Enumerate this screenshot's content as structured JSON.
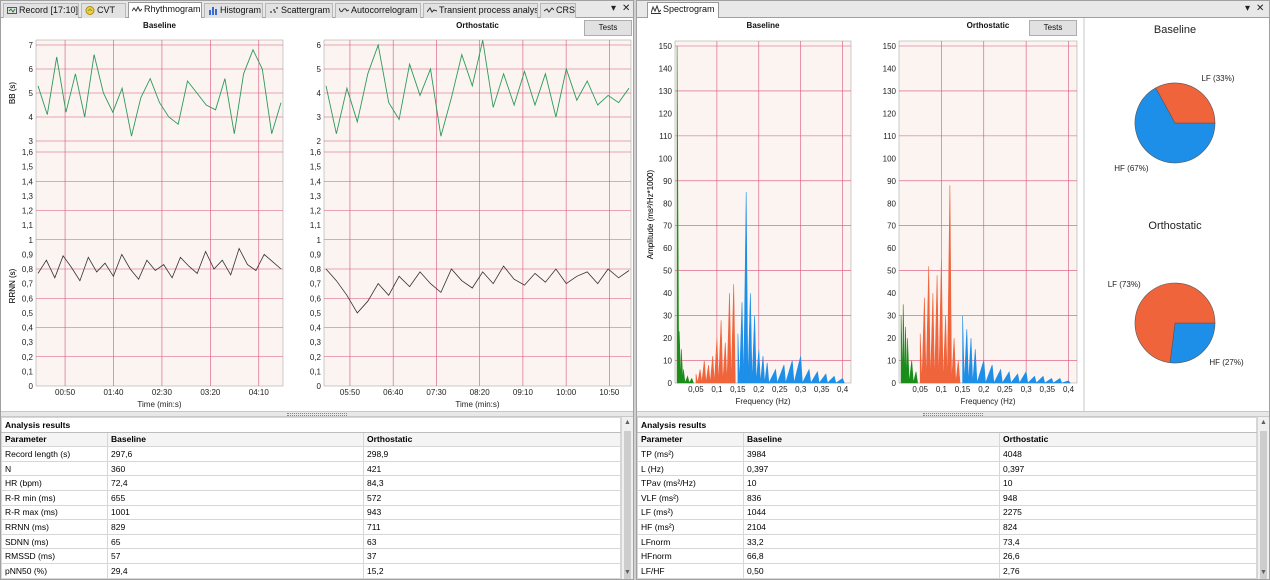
{
  "left_tabs": [
    {
      "label": "Record [17:10]",
      "icon": "record-icon"
    },
    {
      "label": "CVT",
      "icon": "cvt-icon"
    },
    {
      "label": "Rhythmogram",
      "icon": "rhythmogram-icon",
      "active": true
    },
    {
      "label": "Histogram",
      "icon": "histogram-icon"
    },
    {
      "label": "Scattergram",
      "icon": "scattergram-icon"
    },
    {
      "label": "Autocorrelogram",
      "icon": "autocorrelogram-icon"
    },
    {
      "label": "Transient process analysis",
      "icon": "transient-icon"
    },
    {
      "label": "CRS",
      "icon": "crs-icon"
    }
  ],
  "right_tabs": [
    {
      "label": "Spectrogram",
      "icon": "spectrogram-icon",
      "active": true
    }
  ],
  "window_controls": {
    "pin": "▾",
    "close": "✕"
  },
  "tests_label": "Tests",
  "colors": {
    "grid_red": "#d8527a",
    "plot_bg": "#fbf4f1",
    "bb_line": "#2e9a5a",
    "rr_line": "#333333",
    "hf_blue": "#1e8fe8",
    "lf_red": "#f0643c",
    "vlf_green": "#1a8c1a"
  },
  "rhythmogram": {
    "charts": [
      {
        "title": "Baseline",
        "bb_ylabel": "BB (s)",
        "rr_ylabel": "RRNN (s)",
        "xlabel": "Time (min:s)",
        "bb_ticks": [
          "3",
          "4",
          "5",
          "6",
          "7"
        ],
        "rr_ticks": [
          "0",
          "0,1",
          "0,2",
          "0,3",
          "0,4",
          "0,5",
          "0,6",
          "0,7",
          "0,8",
          "0,9",
          "1",
          "1,1",
          "1,2",
          "1,3",
          "1,4",
          "1,5",
          "1,6"
        ],
        "x_ticks": [
          "00:50",
          "01:40",
          "02:30",
          "03:20",
          "04:10"
        ]
      },
      {
        "title": "Orthostatic",
        "bb_ylabel": "BB (s)",
        "rr_ylabel": "RRNN (s)",
        "xlabel": "Time (min:s)",
        "bb_ticks": [
          "2",
          "3",
          "4",
          "5",
          "6"
        ],
        "rr_ticks": [
          "0",
          "0,1",
          "0,2",
          "0,3",
          "0,4",
          "0,5",
          "0,6",
          "0,7",
          "0,8",
          "0,9",
          "1",
          "1,1",
          "1,2",
          "1,3",
          "1,4",
          "1,5",
          "1,6"
        ],
        "x_ticks": [
          "05:50",
          "06:40",
          "07:30",
          "08:20",
          "09:10",
          "10:00",
          "10:50"
        ]
      }
    ]
  },
  "spectrogram": {
    "charts": [
      {
        "title": "Baseline",
        "ylabel": "Amplitude (ms²/Hz*1000)",
        "xlabel": "Frequency (Hz)",
        "y_ticks": [
          "0",
          "10",
          "20",
          "30",
          "40",
          "50",
          "60",
          "70",
          "80",
          "90",
          "100",
          "110",
          "120",
          "130",
          "140",
          "150"
        ],
        "x_ticks": [
          "0,05",
          "0,1",
          "0,15",
          "0,2",
          "0,25",
          "0,3",
          "0,35",
          "0,4"
        ]
      },
      {
        "title": "Orthostatic",
        "ylabel": "Amplitude (ms²/Hz*1000)",
        "xlabel": "Frequency (Hz)",
        "y_ticks": [
          "0",
          "10",
          "20",
          "30",
          "40",
          "50",
          "60",
          "70",
          "80",
          "90",
          "100",
          "110",
          "120",
          "130",
          "140",
          "150"
        ],
        "x_ticks": [
          "0,05",
          "0,1",
          "0,15",
          "0,2",
          "0,25",
          "0,3",
          "0,35",
          "0,4"
        ]
      }
    ],
    "pies": [
      {
        "title": "Baseline",
        "slices": [
          {
            "label": "HF (67%)",
            "value": 67,
            "color": "#1e8fe8"
          },
          {
            "label": "LF (33%)",
            "value": 33,
            "color": "#f0643c"
          }
        ]
      },
      {
        "title": "Orthostatic",
        "slices": [
          {
            "label": "HF (27%)",
            "value": 27,
            "color": "#1e8fe8"
          },
          {
            "label": "LF (73%)",
            "value": 73,
            "color": "#f0643c"
          }
        ]
      }
    ]
  },
  "chart_data": [
    {
      "type": "line",
      "title": "Baseline",
      "ylabel": "BB (s)",
      "xlabel": "Time (min:s)",
      "ylim": [
        3,
        7
      ],
      "series": [
        {
          "values": [
            5.3,
            4.1,
            6.5,
            4.2,
            5.8,
            4.0,
            6.6,
            5.0,
            4.2,
            5.2,
            3.2,
            4.8,
            5.6,
            4.6,
            4.0,
            3.7,
            5.5,
            5.0,
            4.5,
            4.3,
            5.6,
            3.3,
            5.8,
            6.8,
            6.0,
            3.3,
            4.6
          ]
        }
      ]
    },
    {
      "type": "line",
      "title": "Baseline",
      "ylabel": "RRNN (s)",
      "xlabel": "Time (min:s)",
      "ylim": [
        0,
        1.6
      ],
      "series": [
        {
          "values": [
            0.77,
            0.86,
            0.74,
            0.89,
            0.81,
            0.72,
            0.88,
            0.78,
            0.84,
            0.75,
            0.9,
            0.8,
            0.73,
            0.86,
            0.79,
            0.83,
            0.74,
            0.88,
            0.82,
            0.77,
            0.92,
            0.8,
            0.86,
            0.76,
            0.94,
            0.83,
            0.79,
            0.9,
            0.85,
            0.8
          ]
        }
      ]
    },
    {
      "type": "line",
      "title": "Orthostatic",
      "ylabel": "BB (s)",
      "xlabel": "Time (min:s)",
      "ylim": [
        2,
        6
      ],
      "series": [
        {
          "values": [
            4.3,
            2.3,
            4.2,
            2.8,
            4.8,
            6.0,
            3.6,
            2.9,
            5.2,
            3.9,
            5.0,
            2.2,
            3.8,
            5.6,
            4.3,
            6.2,
            3.4,
            4.8,
            3.5,
            4.9,
            3.5,
            4.8,
            3.0,
            5.0,
            3.7,
            4.5,
            3.5,
            3.9,
            3.6,
            4.2
          ]
        }
      ]
    },
    {
      "type": "line",
      "title": "Orthostatic",
      "ylabel": "RRNN (s)",
      "xlabel": "Time (min:s)",
      "ylim": [
        0,
        1.6
      ],
      "series": [
        {
          "values": [
            0.8,
            0.72,
            0.62,
            0.5,
            0.58,
            0.7,
            0.62,
            0.75,
            0.68,
            0.78,
            0.7,
            0.64,
            0.8,
            0.72,
            0.67,
            0.78,
            0.7,
            0.82,
            0.73,
            0.69,
            0.77,
            0.71,
            0.8,
            0.7,
            0.75,
            0.78,
            0.7,
            0.8,
            0.74,
            0.79
          ]
        }
      ]
    },
    {
      "type": "area",
      "title": "Baseline",
      "ylabel": "Amplitude (ms²/Hz*1000)",
      "xlabel": "Frequency (Hz)",
      "ylim": [
        0,
        150
      ],
      "x": [
        0.005,
        0.01,
        0.015,
        0.02,
        0.03,
        0.04,
        0.05,
        0.06,
        0.07,
        0.08,
        0.09,
        0.1,
        0.11,
        0.12,
        0.13,
        0.14,
        0.15,
        0.16,
        0.17,
        0.18,
        0.19,
        0.2,
        0.21,
        0.22,
        0.24,
        0.26,
        0.28,
        0.3,
        0.32,
        0.34,
        0.36,
        0.38,
        0.4
      ],
      "series": [
        {
          "name": "VLF",
          "color": "#1a8c1a",
          "values": [
            150,
            23,
            15,
            6,
            3,
            2,
            0,
            0,
            0,
            0,
            0,
            0,
            0,
            0,
            0,
            0,
            0,
            0,
            0,
            0,
            0,
            0,
            0,
            0,
            0,
            0,
            0,
            0,
            0,
            0,
            0,
            0,
            0
          ]
        },
        {
          "name": "LF",
          "color": "#f0643c",
          "values": [
            0,
            0,
            0,
            0,
            0,
            0,
            4,
            6,
            10,
            8,
            12,
            20,
            28,
            18,
            40,
            44,
            0,
            0,
            0,
            0,
            0,
            0,
            0,
            0,
            0,
            0,
            0,
            0,
            0,
            0,
            0,
            0,
            0
          ]
        },
        {
          "name": "HF",
          "color": "#1e8fe8",
          "values": [
            0,
            0,
            0,
            0,
            0,
            0,
            0,
            0,
            0,
            0,
            0,
            0,
            0,
            0,
            0,
            0,
            22,
            36,
            85,
            40,
            30,
            15,
            12,
            9,
            6,
            8,
            10,
            12,
            6,
            5,
            4,
            3,
            2
          ]
        }
      ]
    },
    {
      "type": "area",
      "title": "Orthostatic",
      "ylabel": "Amplitude (ms²/Hz*1000)",
      "xlabel": "Frequency (Hz)",
      "ylim": [
        0,
        150
      ],
      "x": [
        0.005,
        0.01,
        0.015,
        0.02,
        0.03,
        0.04,
        0.05,
        0.06,
        0.07,
        0.08,
        0.09,
        0.1,
        0.11,
        0.12,
        0.13,
        0.14,
        0.15,
        0.16,
        0.17,
        0.18,
        0.2,
        0.22,
        0.24,
        0.26,
        0.28,
        0.3,
        0.32,
        0.34,
        0.36,
        0.38,
        0.4
      ],
      "series": [
        {
          "name": "VLF",
          "color": "#1a8c1a",
          "values": [
            30,
            35,
            25,
            20,
            10,
            5,
            0,
            0,
            0,
            0,
            0,
            0,
            0,
            0,
            0,
            0,
            0,
            0,
            0,
            0,
            0,
            0,
            0,
            0,
            0,
            0,
            0,
            0,
            0,
            0,
            0
          ]
        },
        {
          "name": "LF",
          "color": "#f0643c",
          "values": [
            0,
            0,
            0,
            0,
            0,
            0,
            22,
            38,
            52,
            40,
            48,
            55,
            30,
            88,
            20,
            10,
            0,
            0,
            0,
            0,
            0,
            0,
            0,
            0,
            0,
            0,
            0,
            0,
            0,
            0,
            0
          ]
        },
        {
          "name": "HF",
          "color": "#1e8fe8",
          "values": [
            0,
            0,
            0,
            0,
            0,
            0,
            0,
            0,
            0,
            0,
            0,
            0,
            0,
            0,
            0,
            0,
            30,
            24,
            20,
            15,
            10,
            8,
            6,
            5,
            4,
            5,
            3,
            3,
            2,
            2,
            1
          ]
        }
      ]
    },
    {
      "type": "pie",
      "title": "Baseline",
      "series": [
        {
          "values": [
            67,
            33
          ]
        }
      ],
      "categories": [
        "HF (67%)",
        "LF (33%)"
      ]
    },
    {
      "type": "pie",
      "title": "Orthostatic",
      "series": [
        {
          "values": [
            27,
            73
          ]
        }
      ],
      "categories": [
        "HF (27%)",
        "LF (73%)"
      ]
    }
  ],
  "left_table": {
    "caption": "Analysis results",
    "headers": [
      "Parameter",
      "Baseline",
      "Orthostatic"
    ],
    "rows": [
      [
        "Record length (s)",
        "297,6",
        "298,9"
      ],
      [
        "N",
        "360",
        "421"
      ],
      [
        "HR (bpm)",
        "72,4",
        "84,3"
      ],
      [
        "R-R min (ms)",
        "655",
        "572"
      ],
      [
        "R-R max (ms)",
        "1001",
        "943"
      ],
      [
        "RRNN (ms)",
        "829",
        "711"
      ],
      [
        "SDNN (ms)",
        "65",
        "63"
      ],
      [
        "RMSSD (ms)",
        "57",
        "37"
      ],
      [
        "pNN50 (%)",
        "29,4",
        "15,2"
      ]
    ]
  },
  "right_table": {
    "caption": "Analysis results",
    "headers": [
      "Parameter",
      "Baseline",
      "Orthostatic"
    ],
    "rows": [
      [
        "TP (ms²)",
        "3984",
        "4048"
      ],
      [
        "L (Hz)",
        "0,397",
        "0,397"
      ],
      [
        "TPav (ms²/Hz)",
        "10",
        "10"
      ],
      [
        "VLF (ms²)",
        "836",
        "948"
      ],
      [
        "LF (ms²)",
        "1044",
        "2275"
      ],
      [
        "HF (ms²)",
        "2104",
        "824"
      ],
      [
        "LFnorm",
        "33,2",
        "73,4"
      ],
      [
        "HFnorm",
        "66,8",
        "26,6"
      ],
      [
        "LF/HF",
        "0,50",
        "2,76"
      ]
    ]
  }
}
